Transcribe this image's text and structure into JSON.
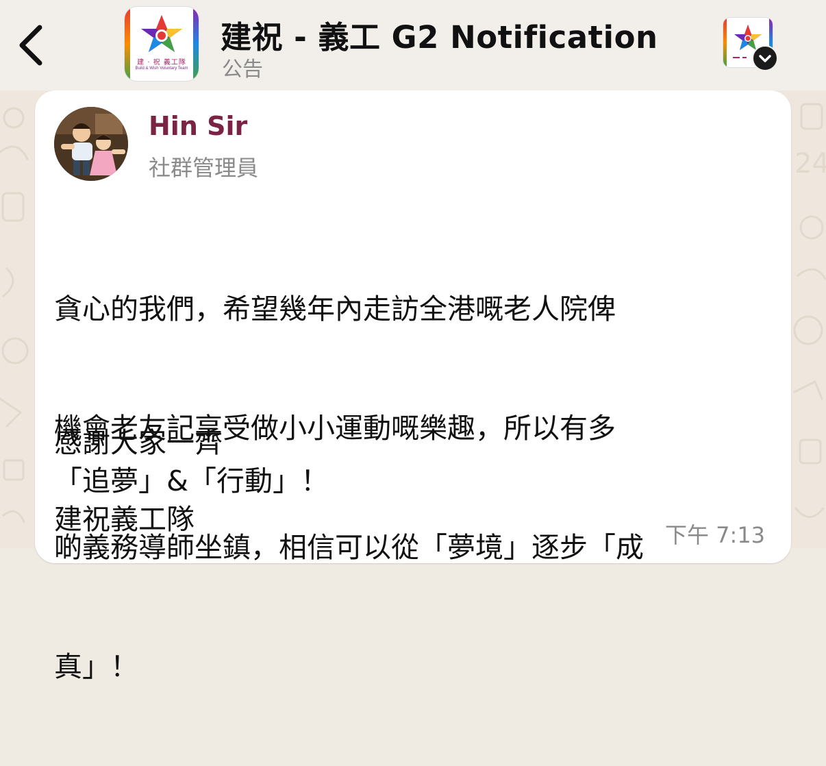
{
  "header": {
    "title": "建祝 - 義工 G2 Notification",
    "subtitle": "公告",
    "group_logo": {
      "name_zh": "建 · 祝  義工隊",
      "name_en": "Build & Wish Voluntary Team"
    }
  },
  "message": {
    "sender_name": "Hin Sir",
    "sender_role": "社群管理員",
    "paragraph_lines": [
      "貪心的我們，希望幾年內走訪全港嘅老人院俾",
      "機會老友記享受做小小運動嘅樂趣，所以有多",
      "啲義務導師坐鎮，相信可以從「夢境」逐步「成",
      "真」！"
    ],
    "closing_lines": [
      "感謝大家一齊",
      "「追夢」&「行動」！",
      "建祝義工隊"
    ],
    "time": "下午 7:13"
  },
  "colors": {
    "header_bg": "#f2efeb",
    "sender_name": "#7b2344",
    "muted_text": "#8a8a8a",
    "wallpaper": "#efe7dd"
  },
  "icons": {
    "back": "chevron-left-icon",
    "profile_badge": "chevron-down-icon"
  }
}
